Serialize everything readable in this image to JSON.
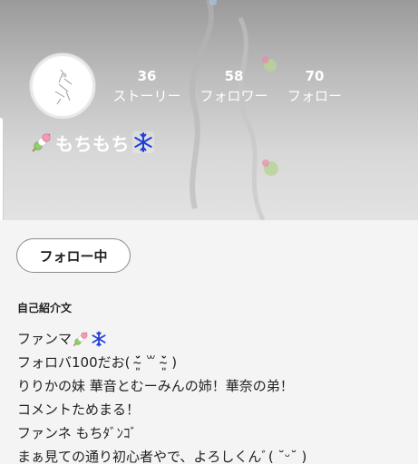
{
  "profile": {
    "name": "もちもち",
    "stats": [
      {
        "value": "36",
        "label": "ストーリー"
      },
      {
        "value": "58",
        "label": "フォロワー"
      },
      {
        "value": "70",
        "label": "フォロー"
      }
    ]
  },
  "actions": {
    "follow_label": "フォロー中"
  },
  "bio": {
    "heading": "自己紹介文",
    "line1": "ファンマ",
    "line2": "フォロバ100だお( ˘̴͈́ ꒳ ˘̴͈̀ )",
    "line3": "りりかの妹 華音とむーみんの姉！華奈の弟！",
    "line4": "コメントためまる！",
    "line5": "ファンネ もちﾀﾞﾝｺﾞ",
    "line6": "まぁ見ての通り初心者やで、よろしくんﾞ( ˘ᵕ˘ )"
  },
  "icons": {
    "dango": "dango-icon",
    "snowflake": "snowflake-icon"
  },
  "colors": {
    "header_top": "#9a9a9a",
    "header_bottom": "#e2e2e2",
    "snowflake": "#1f3fd6",
    "dango_pink": "#f29ab8",
    "dango_white": "#ffffff",
    "dango_green": "#8fd06a"
  }
}
